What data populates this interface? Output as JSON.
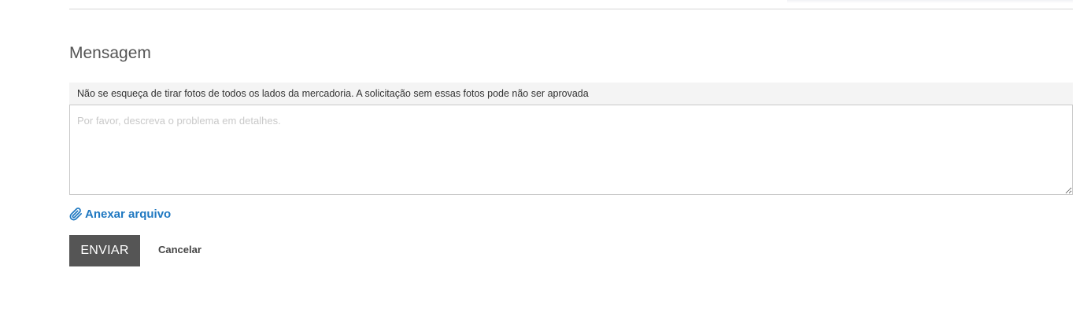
{
  "section": {
    "title": "Mensagem"
  },
  "notice": {
    "text": "Não se esqueça de tirar fotos de todos os lados da mercadoria. A solicitação sem essas fotos pode não ser aprovada"
  },
  "message": {
    "value": "",
    "placeholder": "Por favor, descreva o problema em detalhes."
  },
  "attach": {
    "label": "Anexar arquivo",
    "icon": "paperclip-icon",
    "color": "#1f78c1"
  },
  "actions": {
    "send_label": "ENVIAR",
    "cancel_label": "Cancelar",
    "send_color": "#555555"
  }
}
